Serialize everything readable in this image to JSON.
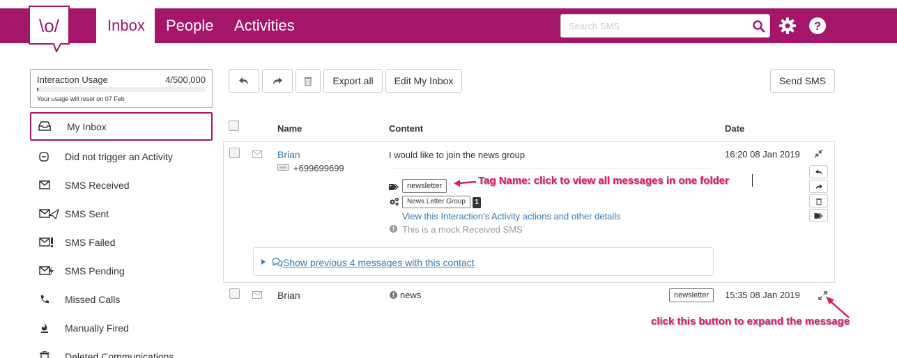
{
  "header": {
    "logo_text": "\\o/",
    "tabs": [
      {
        "label": "Inbox",
        "active": true
      },
      {
        "label": "People",
        "active": false
      },
      {
        "label": "Activities",
        "active": false
      }
    ],
    "search_placeholder": "Search SMS",
    "icons": [
      "search-icon",
      "gear-icon",
      "help-icon"
    ],
    "brand_color": "#a5166a"
  },
  "usage": {
    "label": "Interaction Usage",
    "count": "4/500,000",
    "progress_fraction": 0.008,
    "reset_note": "Your usage will reset on 07 Feb"
  },
  "sidebar": {
    "items": [
      {
        "label": "My Inbox",
        "icon": "inbox-icon",
        "active": true
      },
      {
        "label": "Did not trigger an Activity",
        "icon": "minus-circle-icon"
      },
      {
        "label": "SMS Received",
        "icon": "envelope-icon"
      },
      {
        "label": "SMS Sent",
        "icon": "envelope-sent-icon"
      },
      {
        "label": "SMS Failed",
        "icon": "envelope-failed-icon"
      },
      {
        "label": "SMS Pending",
        "icon": "envelope-pending-icon"
      },
      {
        "label": "Missed Calls",
        "icon": "phone-icon"
      },
      {
        "label": "Manually Fired",
        "icon": "fire-icon"
      },
      {
        "label": "Deleted Communications",
        "icon": "trash-icon"
      }
    ]
  },
  "toolbar": {
    "reply_icon": "reply-icon",
    "forward_icon": "forward-icon",
    "delete_icon": "trash-icon",
    "export_label": "Export all",
    "edit_label": "Edit My Inbox",
    "send_label": "Send SMS"
  },
  "table": {
    "headers": {
      "name": "Name",
      "content": "Content",
      "date": "Date"
    },
    "rows": [
      {
        "name": "Brian",
        "phone": "+699699699",
        "content": "I would like to join the news group",
        "date": "16:20 08 Jan 2019",
        "tag": "newsletter",
        "group": "News Letter Group",
        "group_count": "1",
        "activity_link": "View this Interaction's Activity actions and other details",
        "mock_note": "This is a mock Received SMS",
        "show_previous": "Show previous 4 messages with this contact"
      },
      {
        "name": "Brian",
        "content": "news",
        "tag": "newsletter",
        "date": "15:35 08 Jan 2019"
      }
    ]
  },
  "annotations": {
    "tag_note": "Tag Name: click to view all messages in one folder",
    "expand_note": "click this button to expand the message",
    "color": "#e0186a"
  }
}
